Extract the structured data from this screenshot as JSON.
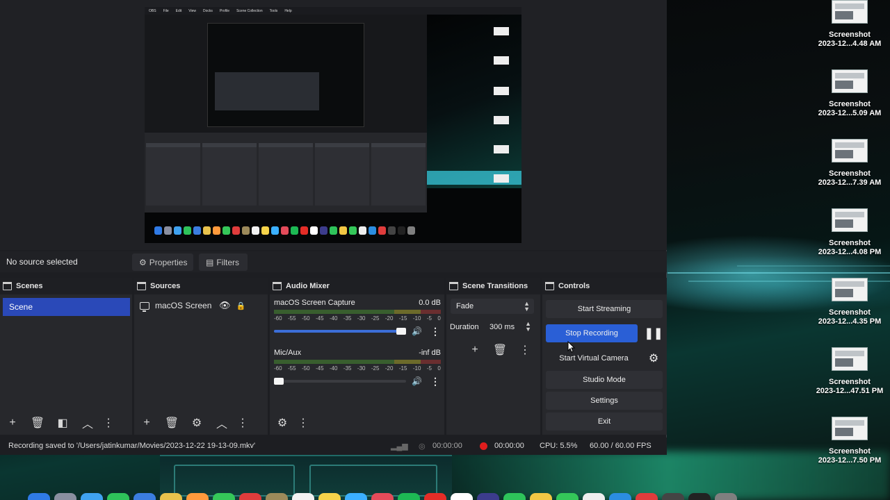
{
  "desktop": {
    "files": [
      {
        "name": "Screenshot",
        "date": "2023-12...4.48 AM"
      },
      {
        "name": "Screenshot",
        "date": "2023-12...5.09 AM"
      },
      {
        "name": "Screenshot",
        "date": "2023-12...7.39 AM"
      },
      {
        "name": "Screenshot",
        "date": "2023-12...4.08 PM"
      },
      {
        "name": "Screenshot",
        "date": "2023-12...4.35 PM"
      },
      {
        "name": "Screenshot",
        "date": "2023-12...47.51 PM"
      },
      {
        "name": "Screenshot",
        "date": "2023-12...7.50 PM"
      }
    ],
    "dock_colors": [
      "#2f7ae5",
      "#8a8fa0",
      "#3fa2f0",
      "#2ec35a",
      "#3b7de0",
      "#e8c24c",
      "#ff9a3c",
      "#35c759",
      "#e03c3c",
      "#9c8a5a",
      "#f2f2f2",
      "#f6d34a",
      "#3bb0ff",
      "#e44b5a",
      "#1db954",
      "#e52d27",
      "#ffffff",
      "#3c3c8c",
      "#2ec35a",
      "#f2c744",
      "#34c759",
      "#eeeeee",
      "#2b8de0",
      "#e03c3c",
      "#444444",
      "#222222",
      "#7f7f7f"
    ]
  },
  "preview": {
    "menubar": [
      "OBS",
      "File",
      "Edit",
      "View",
      "Docks",
      "Profile",
      "Scene Collection",
      "Tools",
      "Help"
    ]
  },
  "properties_bar": {
    "no_source": "No source selected",
    "properties": "Properties",
    "filters": "Filters"
  },
  "scenes": {
    "title": "Scenes",
    "items": [
      "Scene"
    ]
  },
  "sources": {
    "title": "Sources",
    "items": [
      {
        "name": "macOS Screen Ca"
      }
    ]
  },
  "audio_mixer": {
    "title": "Audio Mixer",
    "scale": [
      "-60",
      "-55",
      "-50",
      "-45",
      "-40",
      "-35",
      "-30",
      "-25",
      "-20",
      "-15",
      "-10",
      "-5",
      "0"
    ],
    "channels": [
      {
        "name": "macOS Screen Capture",
        "level": "0.0 dB",
        "volume": 1.0
      },
      {
        "name": "Mic/Aux",
        "level": "-inf dB",
        "volume": 0.0
      }
    ]
  },
  "scene_transitions": {
    "title": "Scene Transitions",
    "transition": "Fade",
    "duration_label": "Duration",
    "duration": "300 ms"
  },
  "controls": {
    "title": "Controls",
    "start_streaming": "Start Streaming",
    "stop_recording": "Stop Recording",
    "start_virtual_camera": "Start Virtual Camera",
    "studio_mode": "Studio Mode",
    "settings": "Settings",
    "exit": "Exit"
  },
  "status": {
    "message": "Recording saved to '/Users/jatinkumar/Movies/2023-12-22 19-13-09.mkv'",
    "stream_time": "00:00:00",
    "record_time": "00:00:00",
    "cpu": "CPU: 5.5%",
    "fps": "60.00 / 60.00 FPS"
  }
}
